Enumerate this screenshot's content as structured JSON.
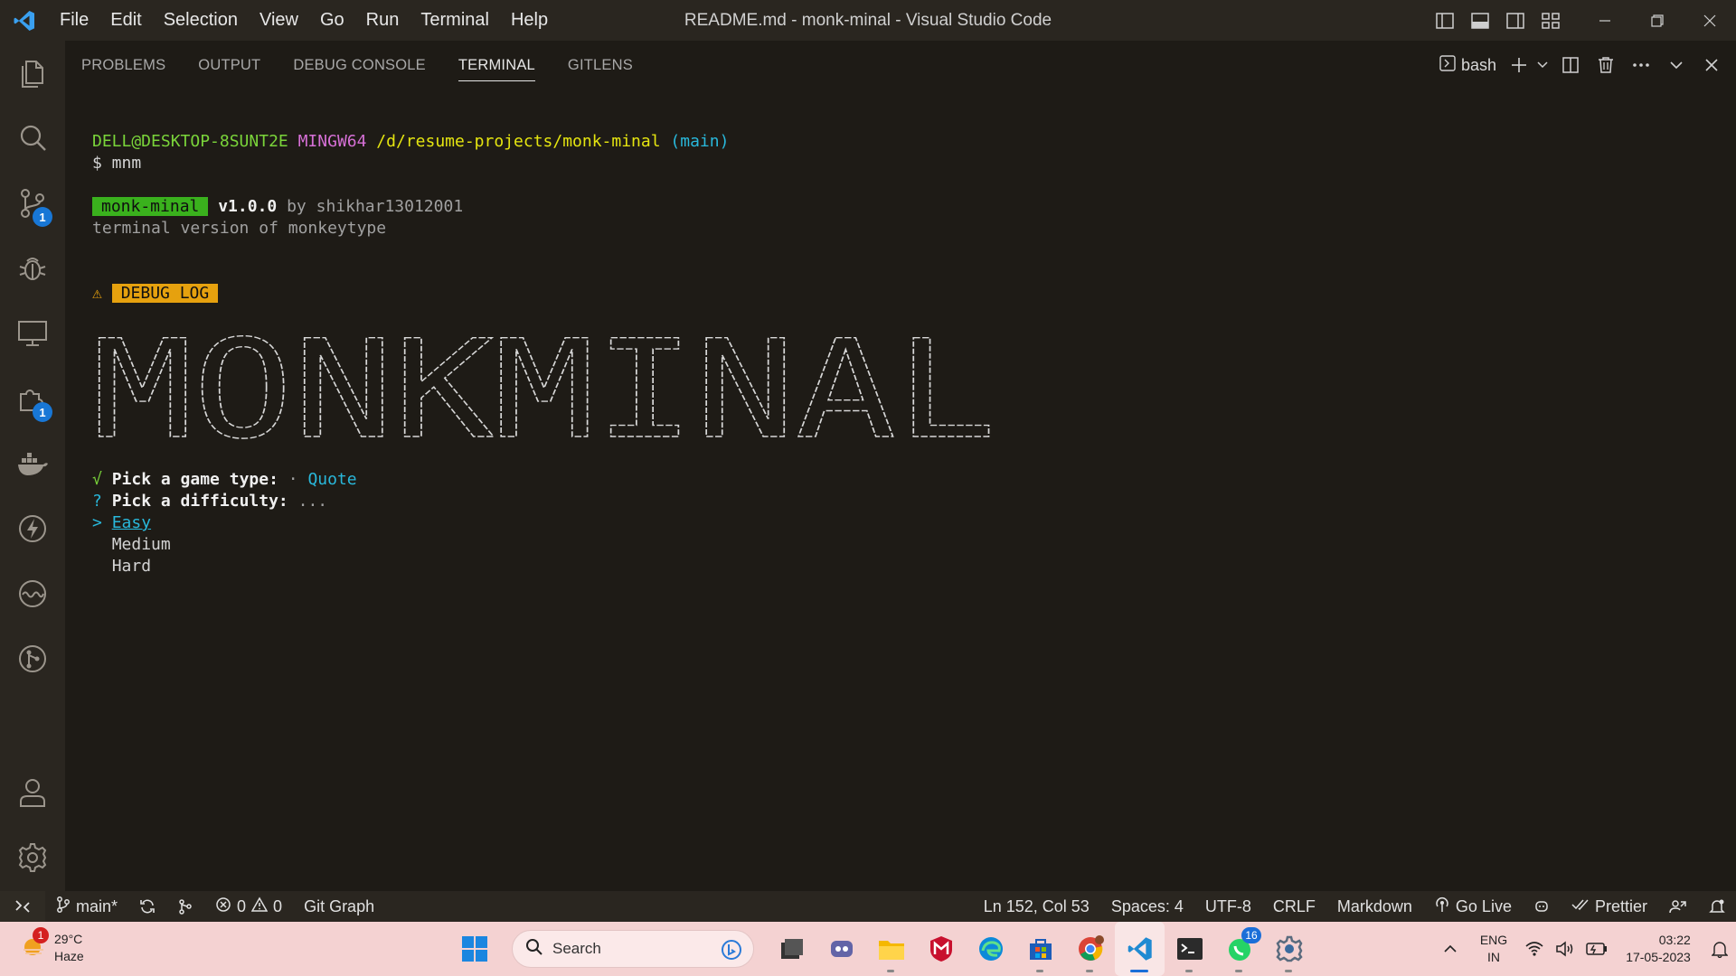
{
  "window": {
    "title": "README.md - monk-minal - Visual Studio Code",
    "menu": [
      "File",
      "Edit",
      "Selection",
      "View",
      "Go",
      "Run",
      "Terminal",
      "Help"
    ]
  },
  "activity_bar": {
    "items": [
      {
        "name": "explorer-icon"
      },
      {
        "name": "search-icon"
      },
      {
        "name": "source-control-icon",
        "badge": "1"
      },
      {
        "name": "debug-icon"
      },
      {
        "name": "remote-explorer-icon"
      },
      {
        "name": "extensions-icon",
        "badge": "1"
      },
      {
        "name": "docker-icon"
      },
      {
        "name": "thunder-client-icon"
      },
      {
        "name": "timeline-icon"
      },
      {
        "name": "git-graph-icon"
      }
    ],
    "bottom": [
      {
        "name": "account-icon"
      },
      {
        "name": "manage-gear-icon"
      }
    ]
  },
  "panel": {
    "tabs": [
      "PROBLEMS",
      "OUTPUT",
      "DEBUG CONSOLE",
      "TERMINAL",
      "GITLENS"
    ],
    "active_tab": "TERMINAL",
    "terminal_name": "bash"
  },
  "terminal": {
    "prompt_user": "DELL@DESKTOP-8SUNT2E",
    "prompt_env": "MINGW64",
    "prompt_path": "/d/resume-projects/monk-minal",
    "prompt_branch": "(main)",
    "command": "$ mnm",
    "app_badge": "monk-minal",
    "version": "v1.0.0",
    "by": "by shikhar13012001",
    "tagline": "terminal version of monkeytype",
    "warning_icon": "⚠",
    "debug_badge": "DEBUG LOG",
    "ascii_art_text": "MONKMINAL",
    "q1_mark": "√",
    "q1_label": "Pick a game type:",
    "q1_sep": "·",
    "q1_answer": "Quote",
    "q2_mark": "?",
    "q2_label": "Pick a difficulty:",
    "q2_hint": "...",
    "pointer": ">",
    "options": [
      "Easy",
      "Medium",
      "Hard"
    ],
    "selected_option": "Easy"
  },
  "status_bar": {
    "branch": "main*",
    "errors": "0",
    "warnings": "0",
    "git_graph": "Git Graph",
    "position": "Ln 152, Col 53",
    "spaces": "Spaces: 4",
    "encoding": "UTF-8",
    "eol": "CRLF",
    "language": "Markdown",
    "go_live": "Go Live",
    "prettier": "Prettier"
  },
  "taskbar": {
    "weather_temp": "29°C",
    "weather_desc": "Haze",
    "weather_badge": "1",
    "search_placeholder": "Search",
    "whatsapp_badge": "16",
    "lang_top": "ENG",
    "lang_bottom": "IN",
    "time": "03:22",
    "date": "17-05-2023"
  },
  "colors": {
    "accent_blue": "#1877d6",
    "terminal_green": "#7ad43a",
    "terminal_magenta": "#d670d6",
    "terminal_yellow": "#e5e510",
    "terminal_cyan": "#29b8db"
  }
}
